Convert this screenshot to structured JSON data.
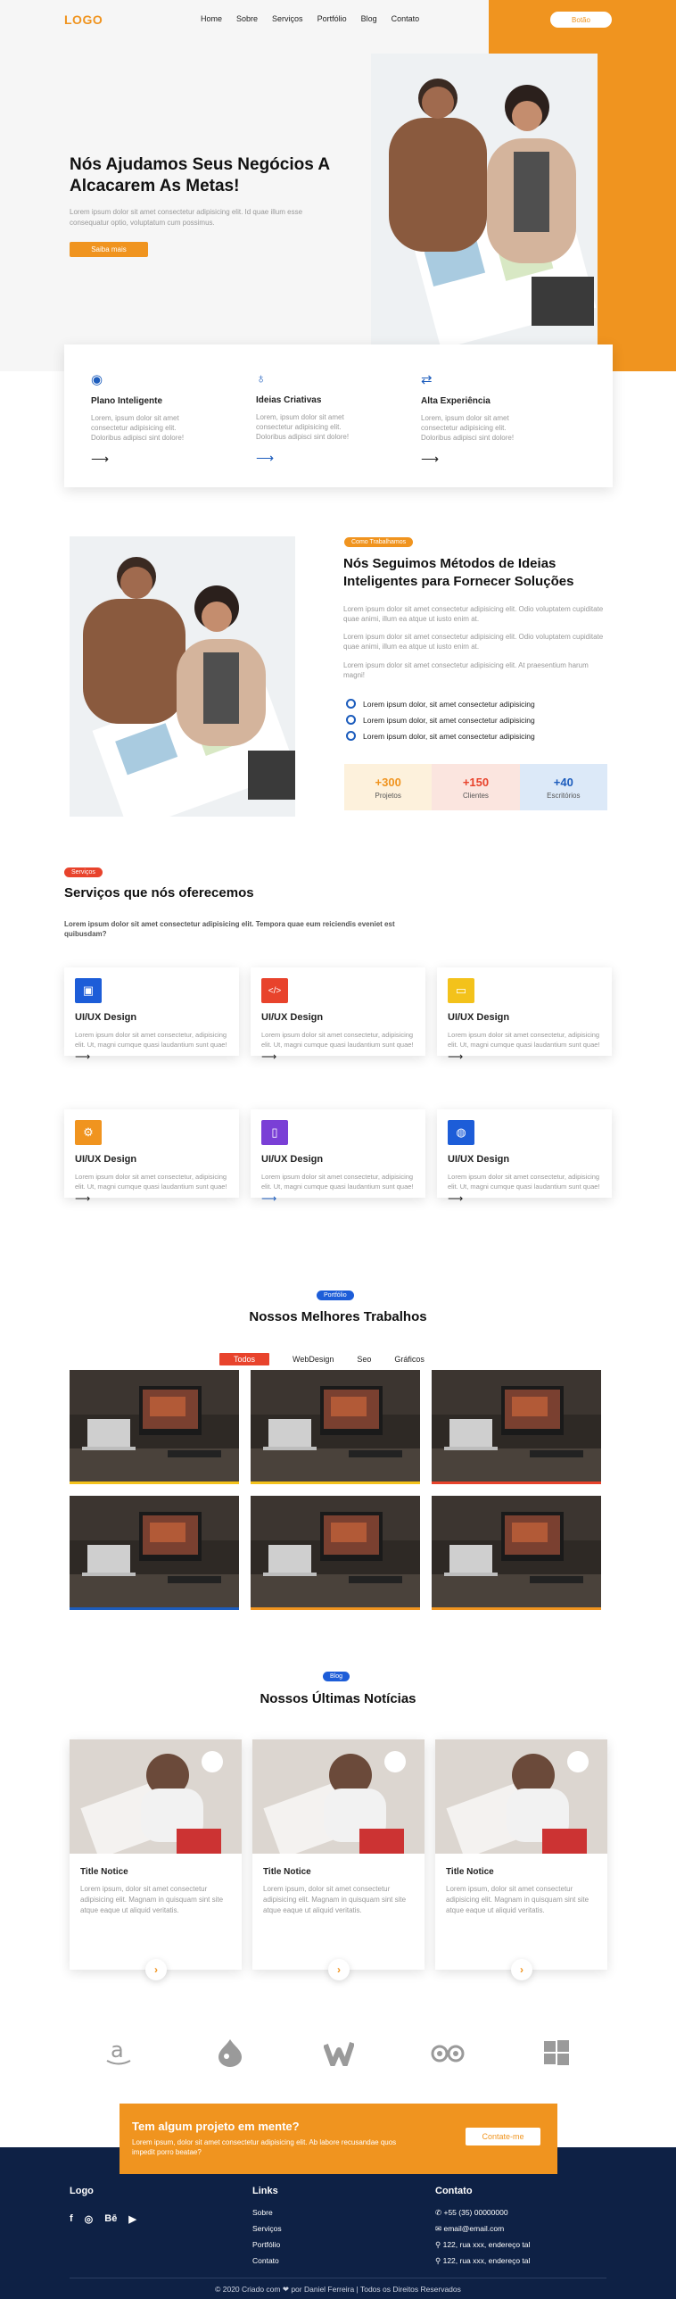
{
  "header": {
    "logo": "LOGO",
    "nav": [
      "Home",
      "Sobre",
      "Serviços",
      "Portfólio",
      "Blog",
      "Contato"
    ],
    "button": "Botão"
  },
  "hero": {
    "title": "Nós Ajudamos Seus Negócios A Alcacarem As Metas!",
    "text": "Lorem ipsum dolor sit amet consectetur adipisicing elit. Id quae illum esse consequatur optio, voluptatum cum possimus.",
    "button": "Saiba mais"
  },
  "features": [
    {
      "icon": "eye-icon",
      "title": "Plano Inteligente",
      "text": "Lorem, ipsum dolor sit amet consectetur adipisicing elit. Doloribus adipisci sint dolore!",
      "arrow": "⟶",
      "color": "#1d5dbd"
    },
    {
      "icon": "lightbulb-icon",
      "title": "Ideias Criativas",
      "text": "Lorem, ipsum dolor sit amet consectetur adipisicing elit. Doloribus adipisci sint dolore!",
      "arrow": "⟶",
      "color": "#1d5dbd"
    },
    {
      "icon": "exchange-icon",
      "title": "Alta Experiência",
      "text": "Lorem, ipsum dolor sit amet consectetur adipisicing elit. Doloribus adipisci sint dolore!",
      "arrow": "⟶",
      "color": "#1d5dbd"
    }
  ],
  "method": {
    "badge": "Como Trabalhamos",
    "title": "Nós Seguimos Métodos de Ideias Inteligentes para Fornecer Soluções",
    "paragraphs": [
      "Lorem ipsum dolor sit amet consectetur adipisicing elit. Odio voluptatem cupiditate quae animi, illum ea atque ut iusto enim at.",
      "Lorem ipsum dolor sit amet consectetur adipisicing elit. Odio voluptatem cupiditate quae animi, illum ea atque ut iusto enim at.",
      "Lorem ipsum dolor sit amet consectetur adipisicing elit. At praesentium harum magni!"
    ],
    "checks": [
      "Lorem ipsum dolor, sit amet consectetur adipisicing",
      "Lorem ipsum dolor, sit amet consectetur adipisicing",
      "Lorem ipsum dolor, sit amet consectetur adipisicing"
    ],
    "stats": [
      {
        "n": "+300",
        "l": "Projetos",
        "bg": "#fdf1dc",
        "c": "#f0941f"
      },
      {
        "n": "+150",
        "l": "Clientes",
        "bg": "#fbe5df",
        "c": "#e8432c"
      },
      {
        "n": "+40",
        "l": "Escritórios",
        "bg": "#dce9f8",
        "c": "#1d5dbd"
      }
    ]
  },
  "services": {
    "badge": "Serviços",
    "title": "Serviços que nós oferecemos",
    "sub": "Lorem ipsum dolor sit amet consectetur adipisicing elit. Tempora quae eum reiciendis eveniet est quibusdam?",
    "cards": [
      {
        "icon": "id-card-icon",
        "glyph": "▣",
        "color": "#1d5dd8",
        "title": "UI/UX Design",
        "text": "Lorem ipsum dolor sit amet consectetur, adipisicing elit. Ut, magni cumque quasi laudantium sunt quae!",
        "arrow": "⟶"
      },
      {
        "icon": "code-icon",
        "glyph": "</>",
        "color": "#e8432c",
        "title": "UI/UX Design",
        "text": "Lorem ipsum dolor sit amet consectetur, adipisicing elit. Ut, magni cumque quasi laudantium sunt quae!",
        "arrow": "⟶"
      },
      {
        "icon": "monitor-icon",
        "glyph": "▭",
        "color": "#f3c21b",
        "title": "UI/UX Design",
        "text": "Lorem ipsum dolor sit amet consectetur, adipisicing elit. Ut, magni cumque quasi laudantium sunt quae!",
        "arrow": "⟶"
      },
      {
        "icon": "gears-icon",
        "glyph": "⚙",
        "color": "#f0941f",
        "title": "UI/UX Design",
        "text": "Lorem ipsum dolor sit amet consectetur, adipisicing elit. Ut, magni cumque quasi laudantium sunt quae!",
        "arrow": "⟶"
      },
      {
        "icon": "mobile-icon",
        "glyph": "▯",
        "color": "#7a3fd6",
        "title": "UI/UX Design",
        "text": "Lorem ipsum dolor sit amet consectetur, adipisicing elit. Ut, magni cumque quasi laudantium sunt quae!",
        "arrow": "⟶"
      },
      {
        "icon": "globe-icon",
        "glyph": "◍",
        "color": "#1d5dd8",
        "title": "UI/UX Design",
        "text": "Lorem ipsum dolor sit amet consectetur, adipisicing elit. Ut, magni cumque quasi laudantium sunt quae!",
        "arrow": "⟶"
      }
    ]
  },
  "portfolio": {
    "badge": "Portfólio",
    "title": "Nossos Melhores Trabalhos",
    "tabs": [
      "Todos",
      "WebDesign",
      "Seo",
      "Gráficos"
    ],
    "accents": [
      "#f3c21b",
      "#f3c21b",
      "#e8432c",
      "#1d5dbd",
      "#f0941f",
      "#f0941f"
    ]
  },
  "blog": {
    "badge": "Blog",
    "title": "Nossos Últimas Notícias",
    "posts": [
      {
        "title": "Title Notice",
        "text": "Lorem ipsum, dolor sit amet consectetur adipisicing elit. Magnam in quisquam sint site atque eaque ut aliquid veritatis."
      },
      {
        "title": "Title Notice",
        "text": "Lorem ipsum, dolor sit amet consectetur adipisicing elit. Magnam in quisquam sint site atque eaque ut aliquid veritatis."
      },
      {
        "title": "Title Notice",
        "text": "Lorem ipsum, dolor sit amet consectetur adipisicing elit. Magnam in quisquam sint site atque eaque ut aliquid veritatis."
      }
    ]
  },
  "brands": [
    "amazon-icon",
    "drupal-icon",
    "wattpad-icon",
    "tripadvisor-icon",
    "windows-icon"
  ],
  "cta": {
    "title": "Tem algum projeto em mente?",
    "text": "Lorem ipsum, dolor sit amet consectetur adipisicing elit. Ab labore recusandae quos impedit porro beatae?",
    "button": "Contate-me"
  },
  "footer": {
    "logo": "Logo",
    "social": [
      "facebook-icon",
      "instagram-icon",
      "behance-icon",
      "youtube-icon"
    ],
    "links_title": "Links",
    "links": [
      "Sobre",
      "Serviços",
      "Portfólio",
      "Contato"
    ],
    "contact_title": "Contato",
    "contacts": [
      "+55 (35) 00000000",
      "email@email.com",
      "122, rua xxx, endereço tal",
      "122, rua xxx, endereço tal"
    ],
    "copyright": "© 2020 Criado com ❤ por Daniel Ferreira | Todos os Direitos Reservados"
  },
  "colors": {
    "orange": "#f0941f",
    "red": "#e8432c",
    "blue": "#1d5dbd",
    "navy": "#0e2145"
  }
}
